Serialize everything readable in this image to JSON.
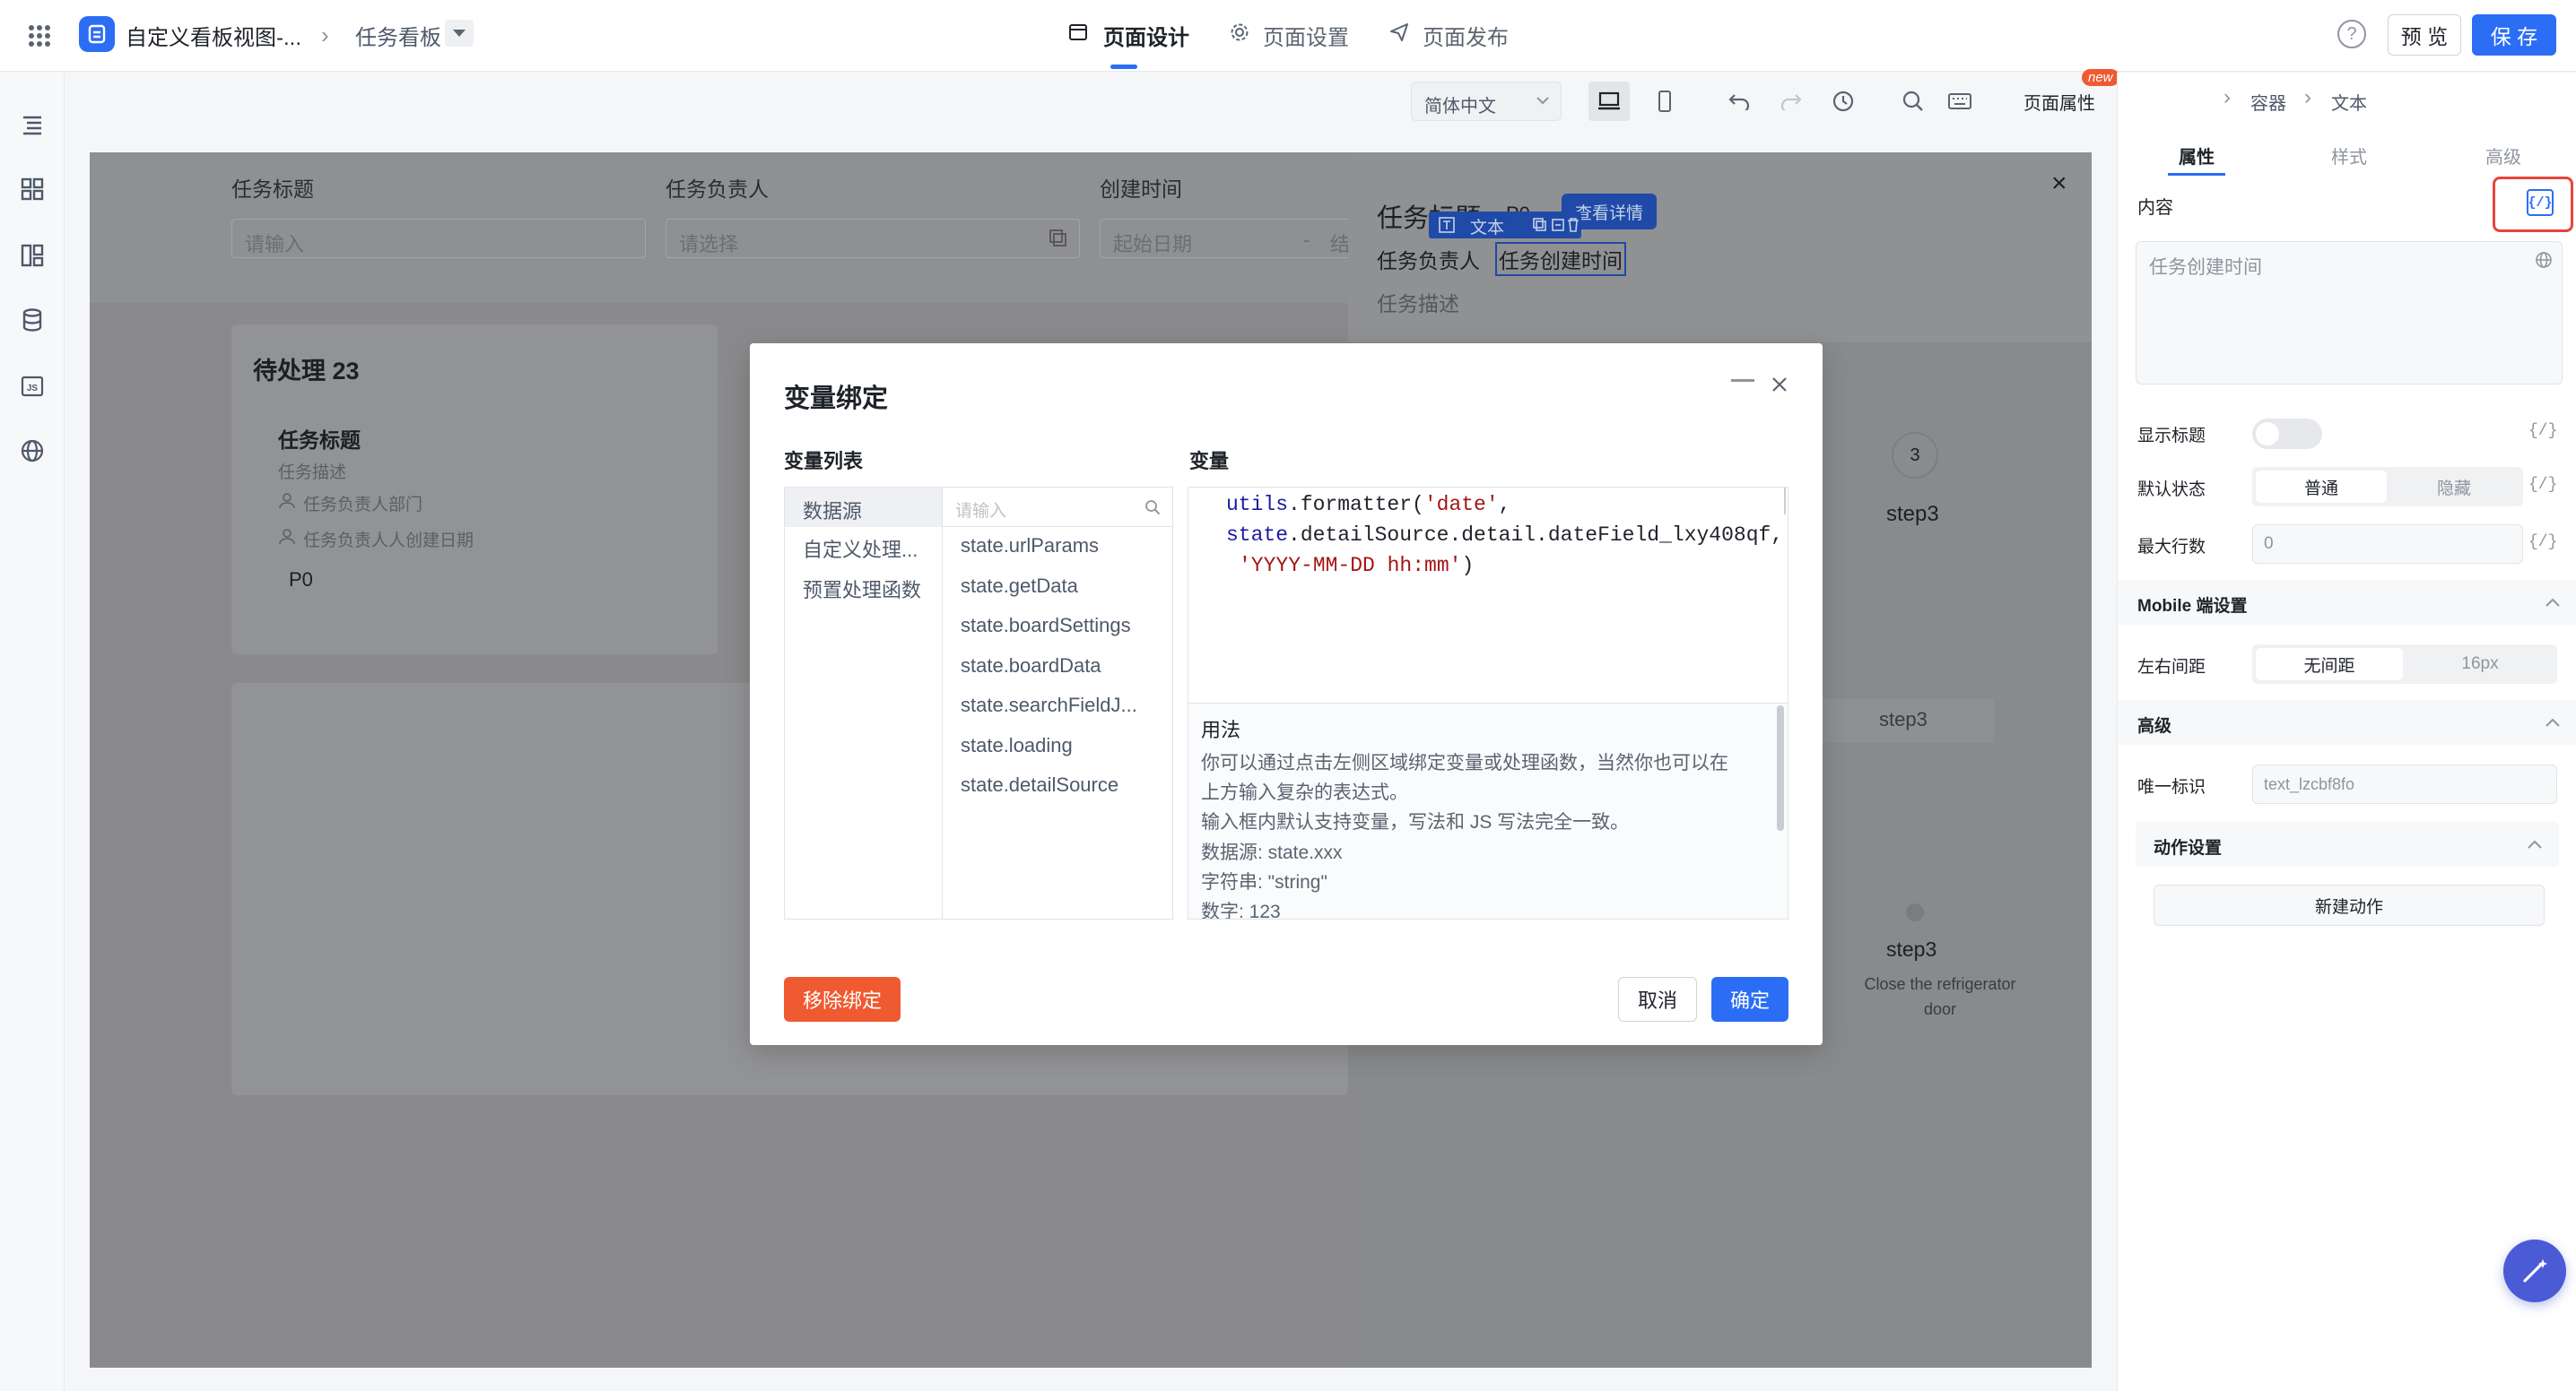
{
  "topbar": {
    "app_name": "自定义看板视图-...",
    "breadcrumb_page": "任务看板",
    "tabs": [
      "页面设计",
      "页面设置",
      "页面发布"
    ],
    "preview_label": "预 览",
    "save_label": "保 存"
  },
  "toolbar": {
    "language": "简体中文",
    "page_props_label": "页面属性",
    "new_badge": "new",
    "breadcrumb": [
      "容器",
      "容器",
      "文本"
    ]
  },
  "canvas": {
    "search_labels": [
      "任务标题",
      "任务负责人",
      "创建时间"
    ],
    "search_placeholders": [
      "请输入",
      "请选择",
      "起始日期",
      "结"
    ],
    "column_title": "待处理 23",
    "card": {
      "title": "任务标题",
      "desc": "任务描述",
      "dept": "任务负责人部门",
      "date": "任务负责人人创建日期",
      "priority": "P0"
    },
    "detail": {
      "title": "任务标题",
      "priority": "P0",
      "view_button": "查看详情",
      "owner_label": "任务负责人",
      "created_time": "任务创建时间",
      "desc": "任务描述",
      "selection_tag": "文本",
      "close": "×"
    },
    "steps": {
      "step_number": "3",
      "step_label_a": "step3",
      "step_label_b": "step3",
      "step_label_c": "step3",
      "step_desc": "Close the refrigerator door"
    }
  },
  "dialog": {
    "title": "变量绑定",
    "left_header": "变量列表",
    "right_header": "变量",
    "categories": [
      "数据源",
      "自定义处理...",
      "预置处理函数"
    ],
    "search_placeholder": "请输入",
    "variables": [
      "state.urlParams",
      "state.getData",
      "state.boardSettings",
      "state.boardData",
      "state.searchFieldJ...",
      "state.loading",
      "state.detailSource"
    ],
    "code": {
      "fn_obj": "utils",
      "fn_name": ".formatter(",
      "arg1": "'date'",
      "comma": ",",
      "state_kw": "state",
      "path": ".detailSource.detail.dateField_lxy408qf,",
      "fmt": "'YYYY-MM-DD hh:mm'",
      "close": ")"
    },
    "usage_title": "用法",
    "usage_lines": [
      "你可以通过点击左侧区域绑定变量或处理函数，当然你也可以在",
      "上方输入复杂的表达式。",
      "输入框内默认支持变量，写法和 JS 写法完全一致。",
      "数据源: state.xxx",
      "字符串: \"string\"",
      "数字: 123"
    ],
    "remove_label": "移除绑定",
    "cancel_label": "取消",
    "confirm_label": "确定"
  },
  "right_panel": {
    "tabs": [
      "属性",
      "样式",
      "高级"
    ],
    "content_label": "内容",
    "content_value": "任务创建时间",
    "show_title_label": "显示标题",
    "default_state_label": "默认状态",
    "default_state_options": [
      "普通",
      "隐藏"
    ],
    "max_lines_label": "最大行数",
    "max_lines_value": "0",
    "mobile_section": "Mobile 端设置",
    "padding_label": "左右间距",
    "padding_options": [
      "无间距",
      "16px"
    ],
    "advanced_section": "高级",
    "uid_label": "唯一标识",
    "uid_value": "text_lzcbf8fo",
    "action_section": "动作设置",
    "new_action": "新建动作",
    "var_icon_text": "{/}"
  },
  "colors": {
    "primary": "#2b6ef5",
    "danger": "#f05a30",
    "highlight": "#e8443a",
    "code_keyword": "#1a1aa6",
    "code_string": "#a31515"
  }
}
